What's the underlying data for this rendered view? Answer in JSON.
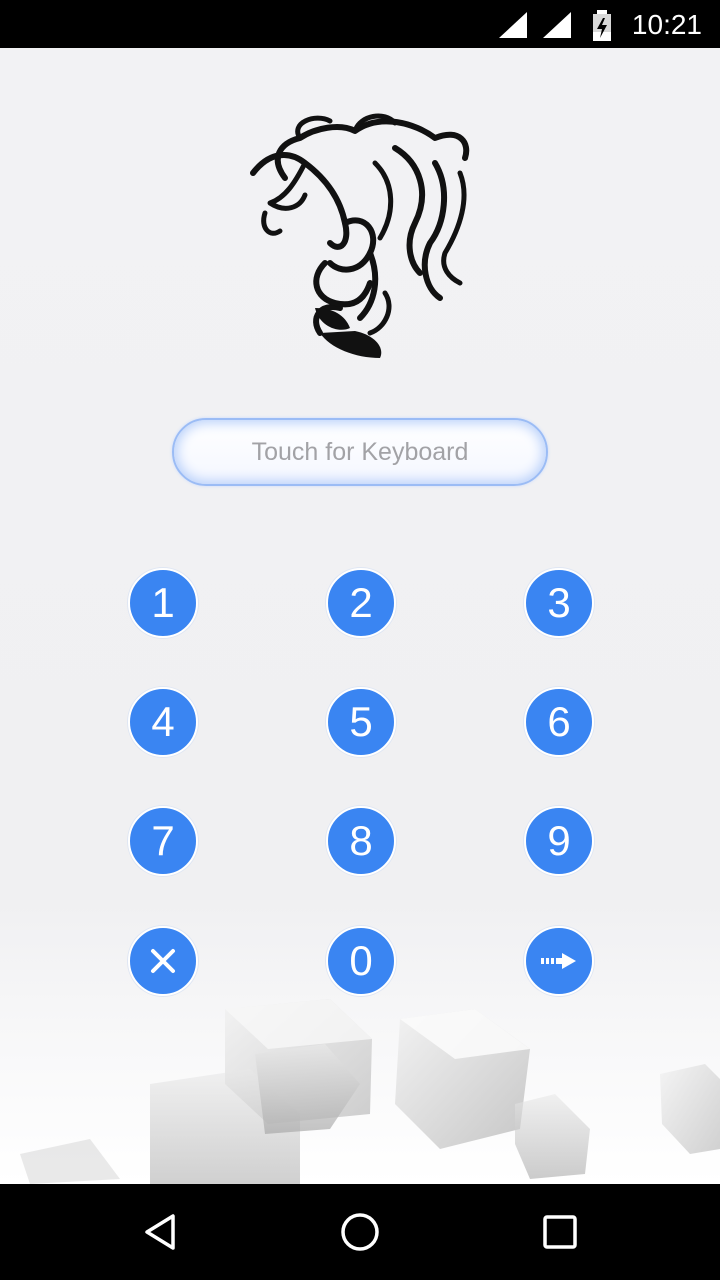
{
  "status_bar": {
    "time": "10:21"
  },
  "unlock": {
    "placeholder": "Touch for Keyboard"
  },
  "keypad": {
    "keys": [
      "1",
      "2",
      "3",
      "4",
      "5",
      "6",
      "7",
      "8",
      "9",
      "",
      "0",
      ""
    ],
    "clear_icon": "close-icon",
    "enter_icon": "arrow-right-icon"
  },
  "colors": {
    "key_blue": "#3a85f2",
    "pill_border": "#9bbcf5"
  },
  "nav": {
    "back_icon": "back-triangle-icon",
    "home_icon": "home-circle-icon",
    "recents_icon": "recents-square-icon"
  }
}
